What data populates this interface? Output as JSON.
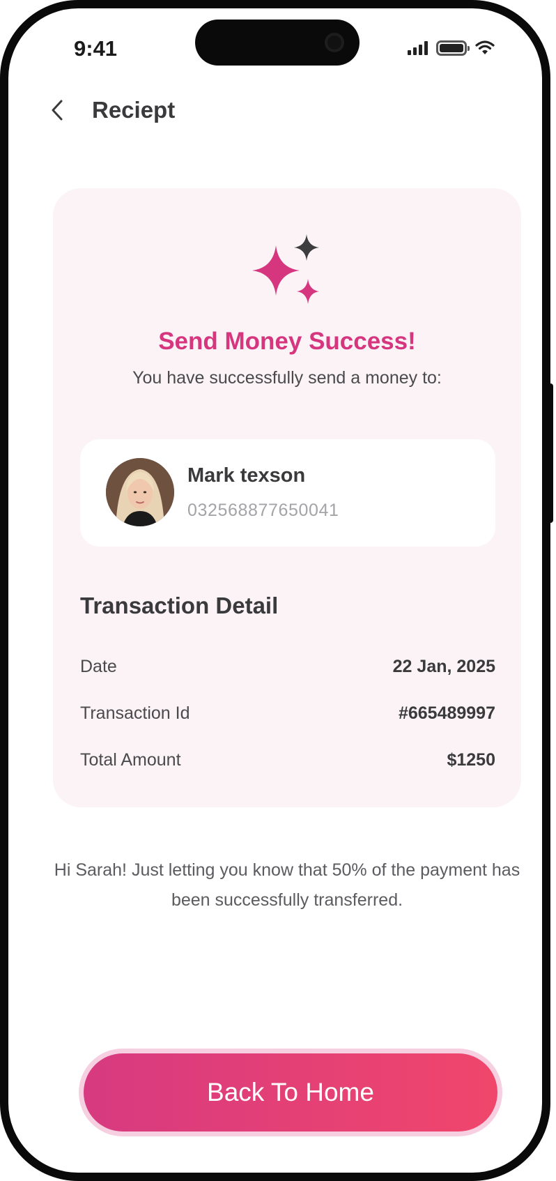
{
  "status_bar": {
    "time": "9:41"
  },
  "header": {
    "title": "Reciept"
  },
  "success": {
    "title": "Send Money Success!",
    "subtitle": "You have successfully send a money to:"
  },
  "recipient": {
    "name": "Mark texson",
    "account": "032568877650041"
  },
  "transaction": {
    "title": "Transaction Detail",
    "rows": [
      {
        "label": "Date",
        "value": "22 Jan, 2025"
      },
      {
        "label": "Transaction Id",
        "value": "#665489997"
      },
      {
        "label": "Total Amount",
        "value": "$1250"
      }
    ]
  },
  "note": "Hi Sarah! Just letting you know that 50% of the payment has been successfully transferred.",
  "cta": {
    "label": "Back To Home"
  },
  "colors": {
    "accent": "#d5367e",
    "card_bg": "#fbf3f6",
    "button_gradient_start": "#d73a80",
    "button_gradient_end": "#f0466c",
    "sparkle_dark": "#3d3d40"
  },
  "icons": {
    "back": "chevron-left-icon",
    "success": "sparkle-icon",
    "signal": "cellular-signal-icon",
    "battery": "battery-icon",
    "wifi": "wifi-icon"
  }
}
